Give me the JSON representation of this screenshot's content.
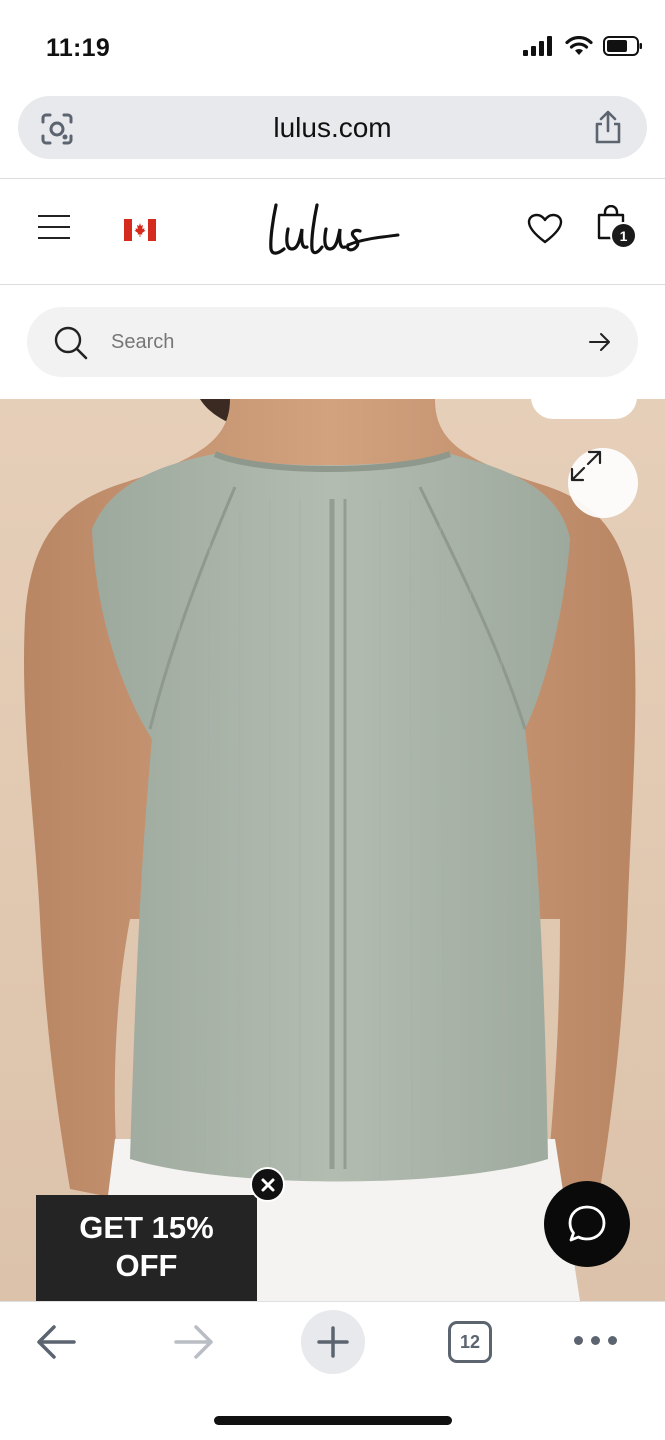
{
  "status_bar": {
    "time": "11:19",
    "icons": [
      "cellular-signal-icon",
      "wifi-icon",
      "battery-icon"
    ]
  },
  "browser": {
    "url": "lulus.com",
    "icons": [
      "camera-lens-icon",
      "share-icon"
    ]
  },
  "header": {
    "brand_logo": "Lulus",
    "country_flag": "canada-flag-icon",
    "bag_count": "1",
    "icons": [
      "menu-icon",
      "heart-icon",
      "shopping-bag-icon"
    ]
  },
  "search": {
    "placeholder": "Search",
    "icons": [
      "search-icon",
      "arrow-right-icon"
    ]
  },
  "product": {
    "image": "Sage green ribbed sleeveless tank top, back view",
    "icons": [
      "expand-icon"
    ]
  },
  "promo": {
    "label": "GET 15% OFF"
  },
  "toolbar": {
    "tab_count": "12",
    "icons": [
      "back-arrow-icon",
      "forward-arrow-icon",
      "plus-icon",
      "tabs-icon",
      "more-icon"
    ]
  },
  "colors": {
    "promo_bg": "#242424",
    "url_bar_bg": "#e8e9ec",
    "search_bg": "#f2f2f2",
    "tank_color": "#a8b3a8",
    "backdrop": "#e3cdb7"
  }
}
